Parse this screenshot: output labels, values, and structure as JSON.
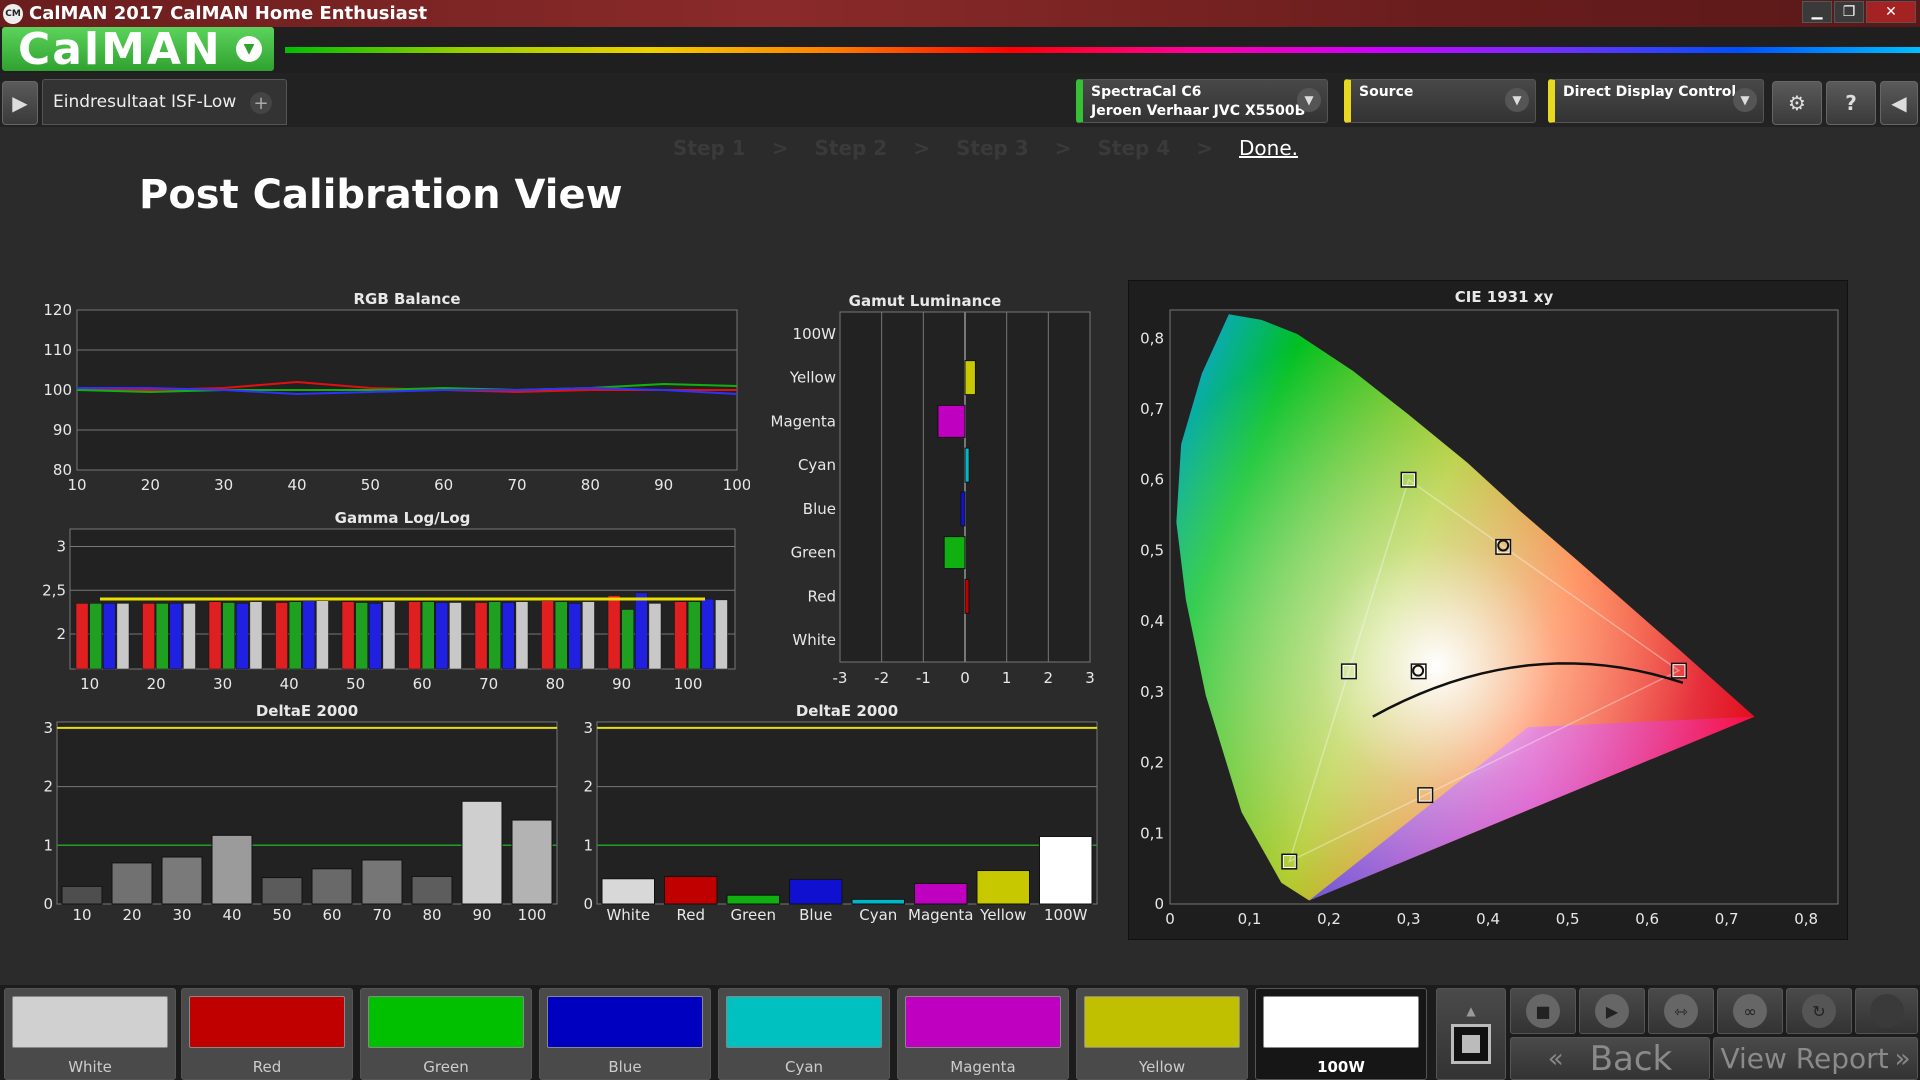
{
  "window": {
    "app_icon": "CM",
    "title": "CalMAN 2017 CalMAN Home Enthusiast",
    "minimize": "▁",
    "maximize": "❐",
    "close": "✕"
  },
  "brand": {
    "name": "CalMAN",
    "dropdown_icon": "chevron-down-icon"
  },
  "toolbar": {
    "tab_label": "Eindresultaat ISF-Low",
    "tab_add": "+",
    "devices": [
      {
        "line1": "SpectraCal C6",
        "line2": "Jeroen Verhaar JVC X5500B",
        "color": "#35c035"
      },
      {
        "line1": "Source",
        "line2": "",
        "color": "#e8d820"
      },
      {
        "line1": "Direct Display Control",
        "line2": "",
        "color": "#e8d820"
      }
    ],
    "settings_icon": "gear-icon",
    "help_label": "?"
  },
  "steps": [
    "Step 1",
    "Step 2",
    "Step 3",
    "Step 4"
  ],
  "step_separator": ">",
  "step_done": "Done.",
  "page_title": "Post Calibration View",
  "charts": {
    "rgb_balance": {
      "title": "RGB Balance",
      "y_ticks": [
        "120",
        "110",
        "100",
        "90",
        "80"
      ],
      "x_ticks": [
        "10",
        "20",
        "30",
        "40",
        "50",
        "60",
        "70",
        "80",
        "90",
        "100"
      ],
      "ylim": [
        80,
        120
      ],
      "x": [
        10,
        20,
        30,
        40,
        50,
        60,
        70,
        80,
        90,
        100
      ],
      "series": [
        {
          "color": "#e01010",
          "values": [
            100,
            100,
            100.5,
            102,
            100.5,
            100,
            99.5,
            100,
            100,
            100
          ]
        },
        {
          "color": "#10b010",
          "values": [
            100,
            99.5,
            100,
            100,
            100,
            100.5,
            100,
            100.5,
            101.5,
            101
          ]
        },
        {
          "color": "#3030ff",
          "values": [
            100.5,
            100.5,
            100,
            99,
            99.5,
            100,
            100,
            100.5,
            100,
            99
          ]
        }
      ]
    },
    "gamma": {
      "title": "Gamma Log/Log",
      "y_ticks": [
        "3",
        "2,5",
        "2"
      ],
      "x_ticks": [
        "10",
        "20",
        "30",
        "40",
        "50",
        "60",
        "70",
        "80",
        "90",
        "100"
      ],
      "ylim": [
        1.6,
        3.2
      ],
      "target": 2.4,
      "groups": [
        [
          2.35,
          2.35,
          2.35,
          2.35
        ],
        [
          2.35,
          2.35,
          2.35,
          2.35
        ],
        [
          2.37,
          2.36,
          2.35,
          2.37
        ],
        [
          2.36,
          2.37,
          2.38,
          2.38
        ],
        [
          2.37,
          2.36,
          2.35,
          2.37
        ],
        [
          2.37,
          2.37,
          2.36,
          2.36
        ],
        [
          2.36,
          2.37,
          2.36,
          2.37
        ],
        [
          2.38,
          2.37,
          2.35,
          2.37
        ],
        [
          2.44,
          2.28,
          2.47,
          2.35
        ],
        [
          2.37,
          2.37,
          2.4,
          2.39
        ]
      ]
    },
    "gamut_luminance": {
      "title": "Gamut Luminance",
      "categories": [
        "100W",
        "Yellow",
        "Magenta",
        "Cyan",
        "Blue",
        "Green",
        "Red",
        "White"
      ],
      "x_ticks": [
        "-3",
        "-2",
        "-1",
        "0",
        "1",
        "2",
        "3"
      ],
      "xlim": [
        -3,
        3
      ],
      "values": [
        0,
        0.25,
        -0.65,
        0.1,
        -0.1,
        -0.5,
        0.07,
        0
      ],
      "colors": [
        "#ffffff",
        "#c8c800",
        "#c000c0",
        "#00b8c8",
        "#1010d0",
        "#10b010",
        "#c00000",
        "#ffffff"
      ]
    },
    "deltae_gray": {
      "title": "DeltaE 2000",
      "y_ticks": [
        "3",
        "2",
        "1",
        "0"
      ],
      "categories": [
        "10",
        "20",
        "30",
        "40",
        "50",
        "60",
        "70",
        "80",
        "90",
        "100"
      ],
      "ylim": [
        0,
        3.1
      ],
      "values": [
        0.3,
        0.7,
        0.8,
        1.17,
        0.45,
        0.6,
        0.75,
        0.47,
        1.75,
        1.43
      ],
      "threshold_high": 3,
      "threshold_low": 1
    },
    "deltae_color": {
      "title": "DeltaE 2000",
      "y_ticks": [
        "3",
        "2",
        "1",
        "0"
      ],
      "categories": [
        "White",
        "Red",
        "Green",
        "Blue",
        "Cyan",
        "Magenta",
        "Yellow",
        "100W"
      ],
      "ylim": [
        0,
        3.1
      ],
      "values": [
        0.43,
        0.47,
        0.15,
        0.42,
        0.08,
        0.35,
        0.57,
        1.15
      ],
      "colors": [
        "#d8d8d8",
        "#c00000",
        "#10b010",
        "#1010d0",
        "#00b8c8",
        "#c000c0",
        "#c8c800",
        "#ffffff"
      ],
      "threshold_high": 3,
      "threshold_low": 1
    },
    "cie": {
      "title": "CIE 1931 xy",
      "x_ticks": [
        "0",
        "0,1",
        "0,2",
        "0,3",
        "0,4",
        "0,5",
        "0,6",
        "0,7",
        "0,8"
      ],
      "y_ticks": [
        "0,8",
        "0,7",
        "0,6",
        "0,5",
        "0,4",
        "0,3",
        "0,2",
        "0,1",
        "0"
      ],
      "xlim": [
        0,
        0.84
      ],
      "ylim": [
        0,
        0.84
      ],
      "targets": [
        {
          "x": 0.64,
          "y": 0.33
        },
        {
          "x": 0.3,
          "y": 0.6
        },
        {
          "x": 0.15,
          "y": 0.06
        },
        {
          "x": 0.225,
          "y": 0.329
        },
        {
          "x": 0.321,
          "y": 0.154
        },
        {
          "x": 0.419,
          "y": 0.505
        },
        {
          "x": 0.3127,
          "y": 0.329
        }
      ],
      "measured": [
        {
          "x": 0.419,
          "y": 0.507
        },
        {
          "x": 0.312,
          "y": 0.33
        }
      ]
    }
  },
  "swatches": [
    {
      "label": "White",
      "color": "#d0d0d0"
    },
    {
      "label": "Red",
      "color": "#c00000"
    },
    {
      "label": "Green",
      "color": "#00c000"
    },
    {
      "label": "Blue",
      "color": "#0000c0"
    },
    {
      "label": "Cyan",
      "color": "#00c0c0"
    },
    {
      "label": "Magenta",
      "color": "#c000c0"
    },
    {
      "label": "Yellow",
      "color": "#c0c000"
    },
    {
      "label": "100W",
      "color": "#ffffff"
    }
  ],
  "controls": {
    "back_label": "Back",
    "report_label": "View Report",
    "icons": [
      "up-icon",
      "stop-icon",
      "play-icon",
      "fit-icon",
      "loop-icon",
      "refresh-icon",
      "record-icon"
    ]
  }
}
